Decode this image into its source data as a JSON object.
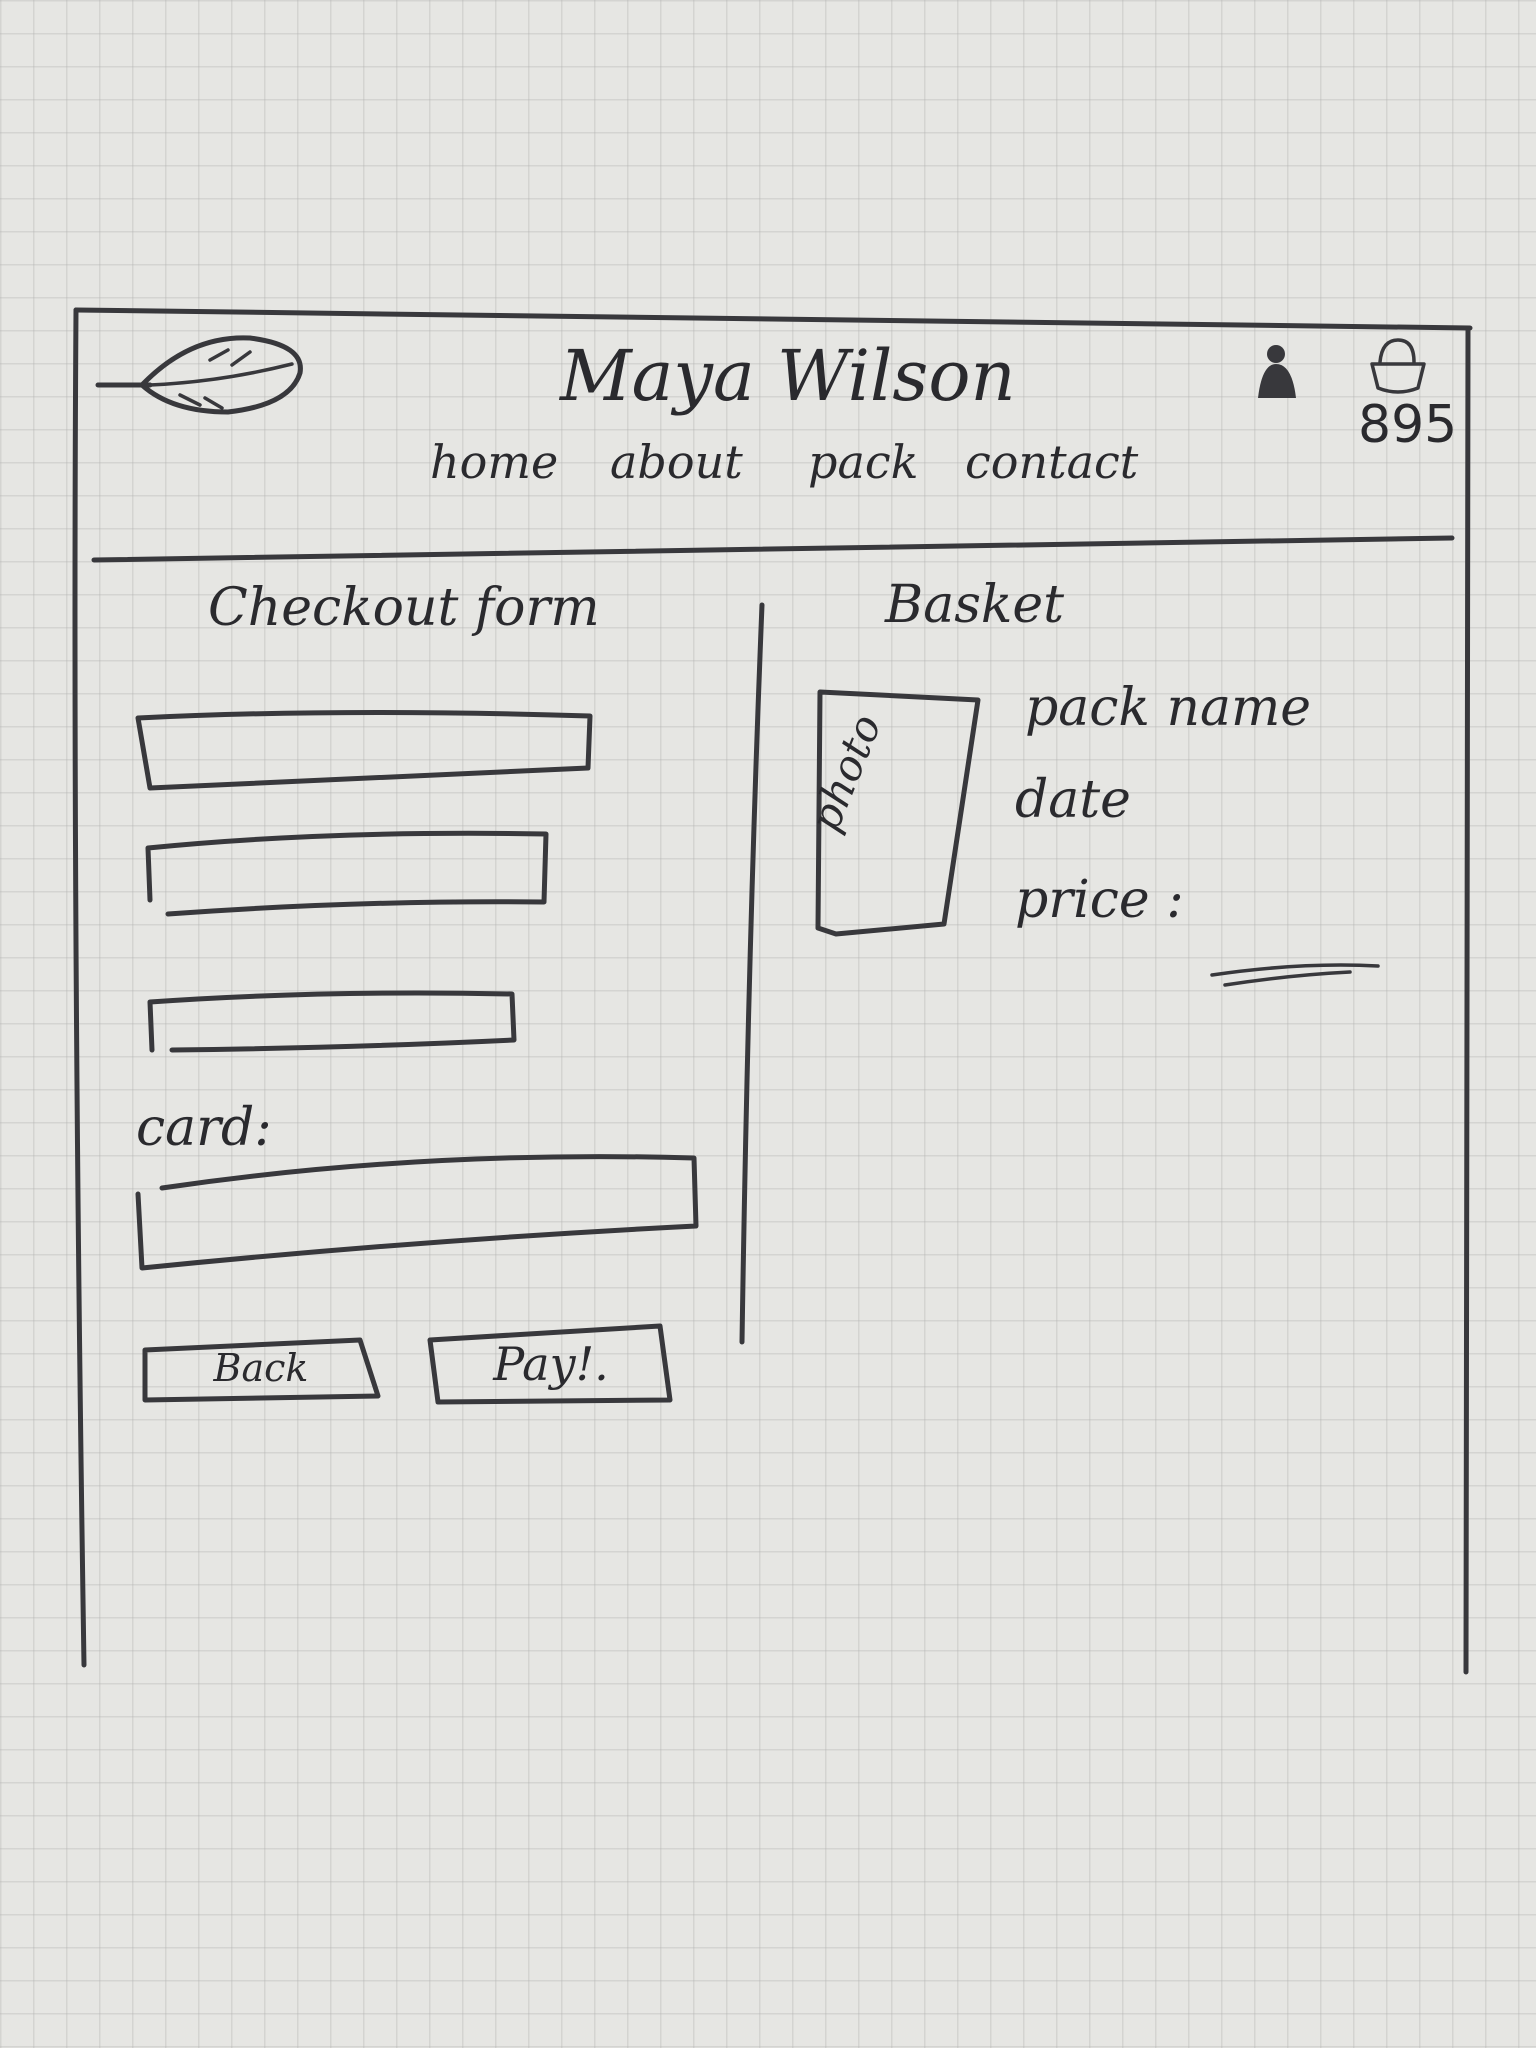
{
  "header": {
    "brand_name": "Maya Wilson",
    "logo_icon": "leaf-icon",
    "nav": [
      {
        "label": "home"
      },
      {
        "label": "about"
      },
      {
        "label": "pack"
      },
      {
        "label": "contact"
      }
    ],
    "account_icon": "user-icon",
    "cart_icon": "basket-icon",
    "cart_count": "895"
  },
  "checkout": {
    "title": "Checkout form",
    "fields": [
      {
        "value": ""
      },
      {
        "value": ""
      },
      {
        "value": ""
      }
    ],
    "card_label": "card:",
    "card_value": "",
    "back_label": "Back",
    "pay_label": "Pay!."
  },
  "basket": {
    "title": "Basket",
    "item": {
      "photo_label": "photo",
      "name": "pack name",
      "date": "date",
      "price": "price :",
      "price_value": ""
    }
  }
}
